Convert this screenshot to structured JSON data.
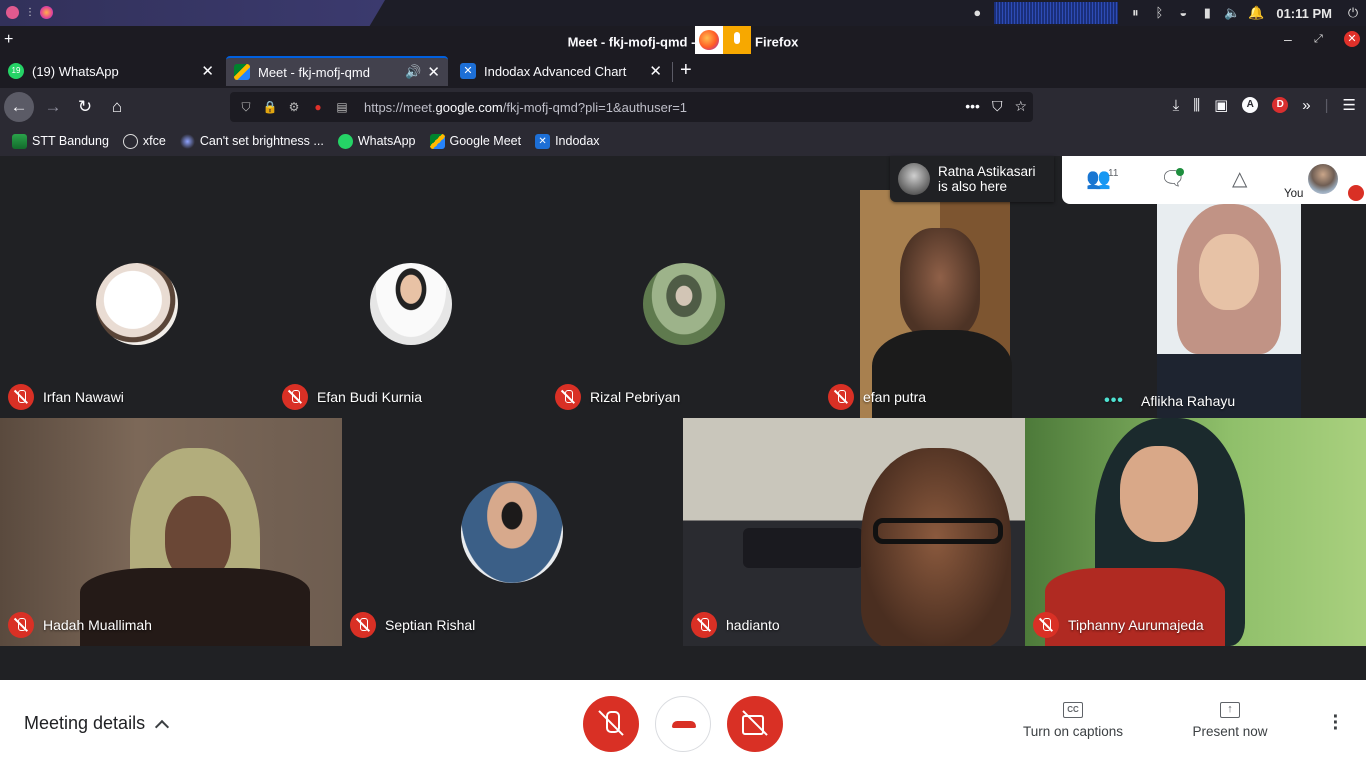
{
  "os_panel": {
    "clock": "01:11 PM"
  },
  "window": {
    "title_left": "Meet - fkj-mofj-qmd -",
    "title_right": "Firefox"
  },
  "tabs": [
    {
      "label": "(19) WhatsApp",
      "badge": "19"
    },
    {
      "label": "Meet - fkj-mofj-qmd"
    },
    {
      "label": "Indodax Advanced Chart"
    }
  ],
  "urlbar": {
    "url_prefix": "https://meet.",
    "url_host": "google.com",
    "url_suffix": "/fkj-mofj-qmd?pli=1&authuser=1"
  },
  "accounts": {
    "a": "A",
    "d": "D"
  },
  "bookmarks": [
    {
      "label": "STT Bandung"
    },
    {
      "label": "xfce"
    },
    {
      "label": "Can't set brightness ..."
    },
    {
      "label": "WhatsApp"
    },
    {
      "label": "Google Meet"
    },
    {
      "label": "Indodax"
    }
  ],
  "notification": {
    "line1": "Ratna Astikasari",
    "line2": "is also here"
  },
  "top_controls": {
    "participants_count": "11",
    "you_label": "You"
  },
  "participants": [
    {
      "name": "Irfan Nawawi",
      "muted": true
    },
    {
      "name": "Efan Budi Kurnia",
      "muted": true
    },
    {
      "name": "Rizal Pebriyan",
      "muted": true
    },
    {
      "name": "efan putra",
      "muted": true
    },
    {
      "name": "Aflikha Rahayu",
      "speaking": true
    },
    {
      "name": "Hadah Muallimah",
      "muted": true
    },
    {
      "name": "Septian Rishal",
      "muted": true
    },
    {
      "name": "hadianto",
      "muted": true
    },
    {
      "name": "Tiphanny Aurumajeda",
      "muted": true
    }
  ],
  "bottom": {
    "meeting_details": "Meeting details",
    "captions": "Turn on captions",
    "captions_icon": "CC",
    "present": "Present now"
  },
  "colors": {
    "meet_red": "#d93025",
    "meet_bg": "#202124",
    "firefox_accent": "#0060df"
  }
}
